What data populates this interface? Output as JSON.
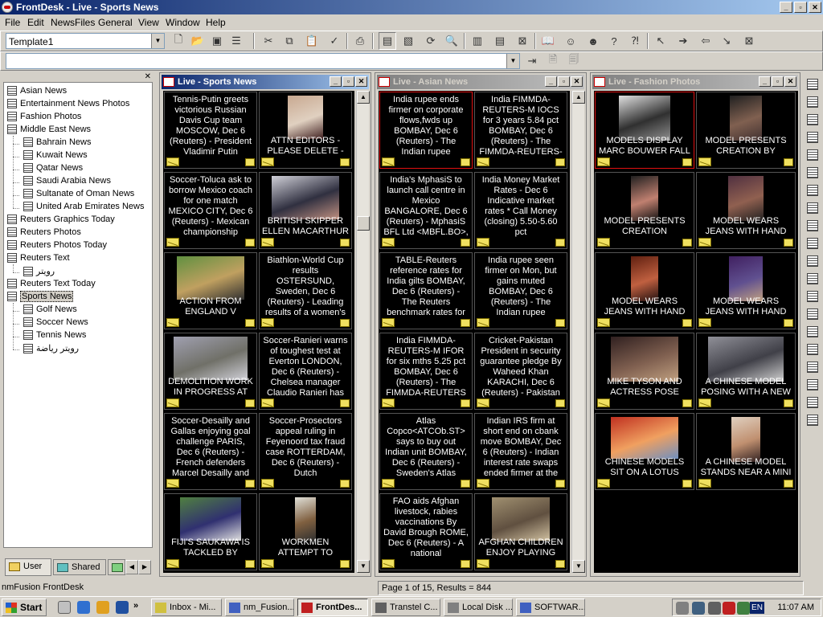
{
  "window": {
    "title": "FrontDesk - Live - Sports News",
    "caption_buttons": [
      "_",
      "▫",
      "✕"
    ]
  },
  "menu": [
    "File",
    "Edit",
    "NewsFiles",
    "General",
    "View",
    "Window",
    "Help"
  ],
  "toolbar": {
    "template_value": "Template1",
    "search_value": ""
  },
  "tree": {
    "items": [
      {
        "label": "Asian News",
        "level": 0
      },
      {
        "label": "Entertainment News Photos",
        "level": 0
      },
      {
        "label": "Fashion Photos",
        "level": 0
      },
      {
        "label": "Middle East News",
        "level": 0
      },
      {
        "label": "Bahrain News",
        "level": 1
      },
      {
        "label": "Kuwait News",
        "level": 1
      },
      {
        "label": "Qatar News",
        "level": 1
      },
      {
        "label": "Saudi Arabia News",
        "level": 1
      },
      {
        "label": "Sultanate of Oman News",
        "level": 1
      },
      {
        "label": "United Arab Emirates News",
        "level": 1
      },
      {
        "label": "Reuters Graphics Today",
        "level": 0
      },
      {
        "label": "Reuters Photos",
        "level": 0
      },
      {
        "label": "Reuters Photos Today",
        "level": 0
      },
      {
        "label": "Reuters Text",
        "level": 0
      },
      {
        "label": "رويتر",
        "level": 1
      },
      {
        "label": "Reuters Text Today",
        "level": 0
      },
      {
        "label": "Sports News",
        "level": 0,
        "selected": true
      },
      {
        "label": "Golf News",
        "level": 1
      },
      {
        "label": "Soccer News",
        "level": 1
      },
      {
        "label": "Tennis News",
        "level": 1
      },
      {
        "label": "رويتر رياضة",
        "level": 1
      }
    ],
    "tabs": [
      "User",
      "Shared",
      ""
    ]
  },
  "windows": [
    {
      "title": "Live - Sports News",
      "active": true,
      "tiles": [
        {
          "type": "text",
          "text": "Tennis-Putin greets victorious Russian Davis Cup team MOSCOW, Dec 6 (Reuters) - President Vladimir Putin"
        },
        {
          "type": "photo",
          "caption": "ATTN EDITORS - PLEASE DELETE -",
          "photo": {
            "w": 44,
            "h": 54,
            "colors": [
              "#c8a890",
              "#e0d0c0",
              "#402020"
            ]
          }
        },
        {
          "type": "text",
          "text": "Soccer-Toluca ask to borrow Mexico coach for one match MEXICO CITY, Dec 6 (Reuters) - Mexican championship"
        },
        {
          "type": "photo",
          "caption": "BRITISH SKIPPER ELLEN MACARTHUR",
          "photo": {
            "w": 84,
            "h": 54,
            "colors": [
              "#d0d0d8",
              "#303040",
              "#c09080"
            ]
          }
        },
        {
          "type": "photo",
          "caption": "ACTION FROM ENGLAND V",
          "photo": {
            "w": 84,
            "h": 54,
            "colors": [
              "#609040",
              "#c0a060",
              "#303030"
            ]
          }
        },
        {
          "type": "text",
          "text": "Biathlon-World Cup results OSTERSUND, Sweden, Dec 6 (Reuters) - Leading results of a women's"
        },
        {
          "type": "photo",
          "caption": "DEMOLITION WORK IN PROGRESS AT",
          "photo": {
            "w": 92,
            "h": 54,
            "colors": [
              "#a0a0b0",
              "#707068",
              "#d0d0d8"
            ]
          }
        },
        {
          "type": "text",
          "text": "Soccer-Ranieri warns of toughest test at Everton LONDON, Dec 6 (Reuters) - Chelsea manager Claudio Ranieri has"
        },
        {
          "type": "text",
          "text": "Soccer-Desailly and Gallas enjoying goal challenge PARIS, Dec 6 (Reuters) - French defenders Marcel Desailly and"
        },
        {
          "type": "text",
          "text": "Soccer-Prosectors appeal ruling in Feyenoord tax fraud case ROTTERDAM, Dec 6 (Reuters) - Dutch"
        },
        {
          "type": "photo",
          "caption": "FIJI'S SAUKAWA IS TACKLED BY",
          "photo": {
            "w": 76,
            "h": 54,
            "colors": [
              "#508040",
              "#303070",
              "#e0e0e0"
            ]
          }
        },
        {
          "type": "photo",
          "caption": "WORKMEN ATTEMPT TO",
          "photo": {
            "w": 26,
            "h": 54,
            "colors": [
              "#e0e0d8",
              "#806040",
              "#303030"
            ]
          }
        }
      ]
    },
    {
      "title": "Live - Asian News",
      "active": false,
      "tiles": [
        {
          "type": "text",
          "highlight": true,
          "text": "India rupee ends firmer on corporate flows,fwds up BOMBAY, Dec 6 (Reuters) - The Indian rupee bounced from"
        },
        {
          "type": "text",
          "text": "India FIMMDA-REUTERS-M IOCS for 3 years 5.84 pct BOMBAY, Dec 6 (Reuters) - The FIMMDA-REUTERS-M"
        },
        {
          "type": "text",
          "text": "India's MphasiS to launch call centre in Mexico BANGALORE, Dec 6 (Reuters) - MphasiS BFL Ltd <MBFL.BO>,"
        },
        {
          "type": "text",
          "text": "India Money Market Rates - Dec 6 Indicative market rates * Call Money (closing) 5.50-5.60 pct"
        },
        {
          "type": "text",
          "text": "TABLE-Reuters reference rates for India gilts BOMBAY, Dec 6 (Reuters) - The Reuters benchmark rates for Indian gilts at"
        },
        {
          "type": "text",
          "text": "India rupee seen firmer on Mon, but gains muted BOMBAY, Dec 6 (Reuters) - The Indian rupee <INR=IN> is seen"
        },
        {
          "type": "text",
          "text": "India FIMMDA-REUTERS-M IFOR for six mths 5.25 pct BOMBAY, Dec 6 (Reuters) - The FIMMDA-REUTERS"
        },
        {
          "type": "text",
          "text": "Cricket-Pakistan President in security guarantee pledge By Waheed Khan KARACHI, Dec 6 (Reuters) - Pakistan"
        },
        {
          "type": "text",
          "text": "Atlas Copco<ATCOb.ST> says to buy out Indian unit BOMBAY, Dec 6 (Reuters) - Sweden's Atlas Copco"
        },
        {
          "type": "text",
          "text": "Indian IRS firm at short end on cbank move BOMBAY, Dec 6 (Reuters) - Indian interest rate swaps ended firmer at the"
        },
        {
          "type": "text",
          "text": "FAO aids Afghan livestock, rabies vaccinations By David Brough ROME, Dec 6 (Reuters) - A national"
        },
        {
          "type": "photo",
          "caption": "AFGHAN CHILDREN ENJOY PLAYING",
          "photo": {
            "w": 72,
            "h": 54,
            "colors": [
              "#a09070",
              "#605040",
              "#d0c0a0"
            ]
          }
        }
      ]
    },
    {
      "title": "Live - Fashion Photos",
      "active": false,
      "tiles": [
        {
          "type": "photo",
          "highlight": true,
          "caption": "MODELS DISPLAY MARC BOUWER FALL",
          "photo": {
            "w": 64,
            "h": 56,
            "colors": [
              "#e0e0e0",
              "#303030",
              "#909090"
            ]
          }
        },
        {
          "type": "photo",
          "caption": "MODEL PRESENTS CREATION BY NIKOLA",
          "photo": {
            "w": 40,
            "h": 56,
            "colors": [
              "#202020",
              "#806050",
              "#403030"
            ]
          }
        },
        {
          "type": "photo",
          "caption": "MODEL PRESENTS CREATION BYSLAVICA",
          "photo": {
            "w": 34,
            "h": 56,
            "colors": [
              "#202020",
              "#c08070",
              "#101010"
            ]
          }
        },
        {
          "type": "photo",
          "caption": "MODEL WEARS JEANS WITH HAND",
          "photo": {
            "w": 44,
            "h": 56,
            "colors": [
              "#503040",
              "#906050",
              "#202020"
            ]
          }
        },
        {
          "type": "photo",
          "caption": "MODEL WEARS JEANS WITH HAND",
          "photo": {
            "w": 34,
            "h": 56,
            "colors": [
              "#602010",
              "#c06040",
              "#201010"
            ]
          }
        },
        {
          "type": "photo",
          "caption": "MODEL WEARS JEANS WITH HAND",
          "photo": {
            "w": 42,
            "h": 56,
            "colors": [
              "#402060",
              "#605090",
              "#c0a080"
            ]
          }
        },
        {
          "type": "photo",
          "caption": "MIKE TYSON AND ACTRESS POSE",
          "photo": {
            "w": 84,
            "h": 56,
            "colors": [
              "#302020",
              "#806050",
              "#c0a080"
            ]
          }
        },
        {
          "type": "photo",
          "caption": "A CHINESE MODEL POSING WITH A NEW",
          "photo": {
            "w": 94,
            "h": 56,
            "colors": [
              "#909098",
              "#404048",
              "#d0d0d0"
            ]
          }
        },
        {
          "type": "photo",
          "caption": "CHINESE MODELS SIT ON A LOTUS ELISE",
          "photo": {
            "w": 84,
            "h": 52,
            "colors": [
              "#c03020",
              "#f0a060",
              "#7090c0"
            ]
          }
        },
        {
          "type": "photo",
          "caption": "A CHINESE MODEL STANDS NEAR A MINI",
          "photo": {
            "w": 36,
            "h": 56,
            "colors": [
              "#e0d0c0",
              "#c09070",
              "#302020"
            ]
          }
        }
      ]
    }
  ],
  "status": {
    "left": "nmFusion FrontDesk",
    "page": "Page 1 of 15, Results = 844"
  },
  "taskbar": {
    "start": "Start",
    "tasks": [
      {
        "label": "Inbox - Mi...",
        "color": "#d0c040"
      },
      {
        "label": "nm_Fusion...",
        "color": "#4060c0"
      },
      {
        "label": "FrontDes...",
        "color": "#c02020",
        "active": true
      },
      {
        "label": "Transtel C...",
        "color": "#606060"
      },
      {
        "label": "Local Disk ...",
        "color": "#808080"
      },
      {
        "label": "SOFTWAR...",
        "color": "#4060c0"
      }
    ],
    "lang": "EN",
    "clock": "11:07 AM"
  }
}
